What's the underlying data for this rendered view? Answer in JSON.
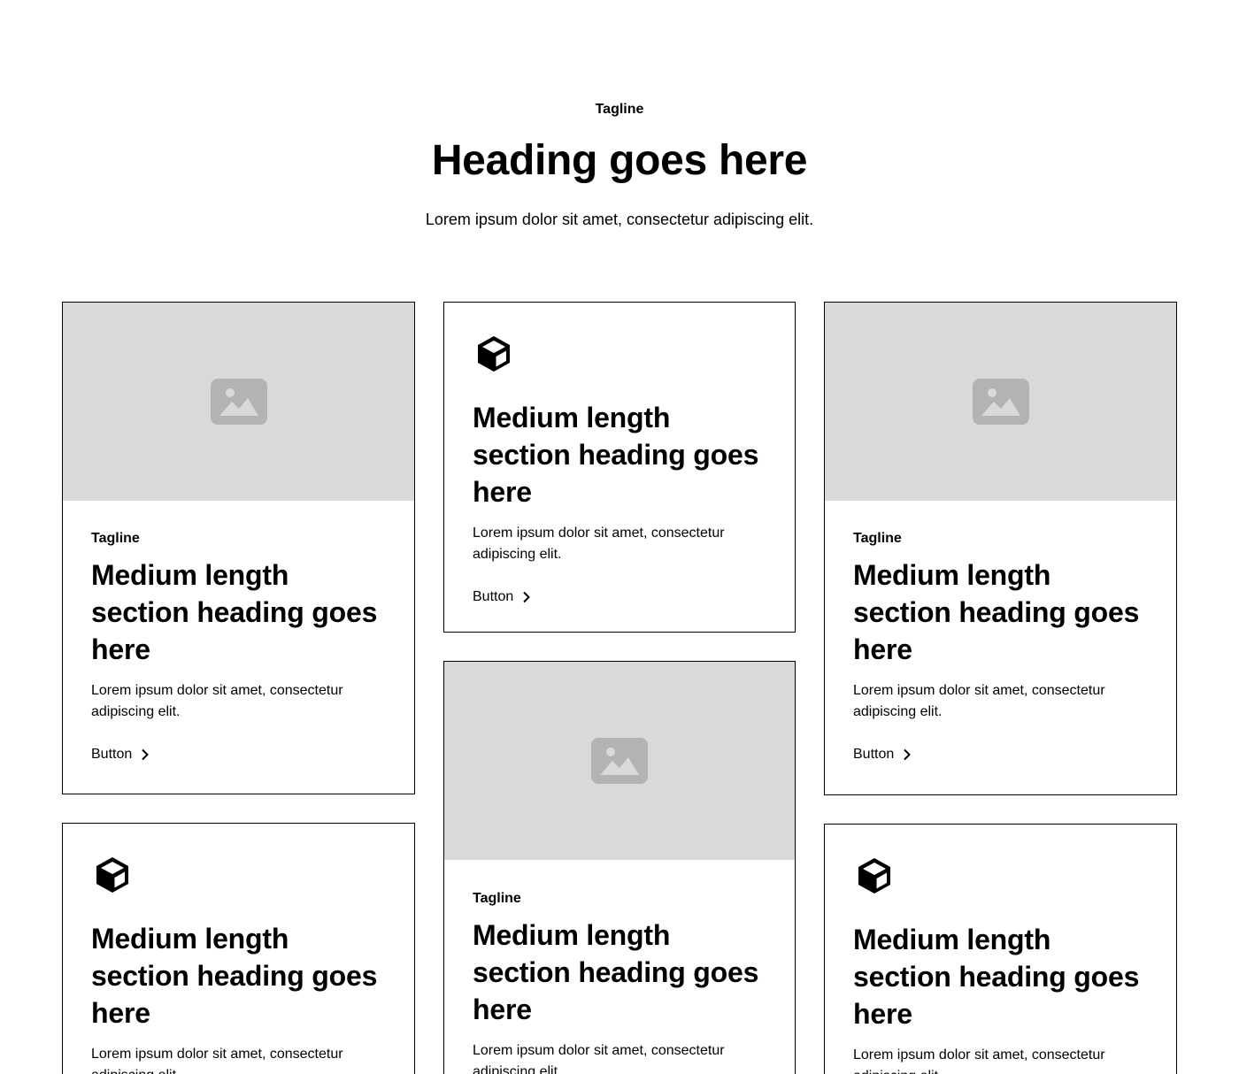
{
  "header": {
    "tagline": "Tagline",
    "title": "Heading goes here",
    "subtitle": "Lorem ipsum dolor sit amet, consectetur adipiscing elit."
  },
  "cards": [
    {
      "kind": "image",
      "tagline": "Tagline",
      "heading": "Medium length section heading goes here",
      "text": "Lorem ipsum dolor sit amet, consectetur adipiscing elit.",
      "button": "Button",
      "icon": "image-placeholder-icon"
    },
    {
      "kind": "icon",
      "heading": "Medium length section heading goes here",
      "text": "Lorem ipsum dolor sit amet, consectetur adipiscing elit.",
      "button": "Button",
      "icon": "cube-icon"
    },
    {
      "kind": "image",
      "tagline": "Tagline",
      "heading": "Medium length section heading goes here",
      "text": "Lorem ipsum dolor sit amet, consectetur adipiscing elit.",
      "button": "Button",
      "icon": "image-placeholder-icon"
    },
    {
      "kind": "icon",
      "heading": "Medium length section heading goes here",
      "text": "Lorem ipsum dolor sit amet, consectetur adipiscing elit.",
      "icon": "cube-icon"
    },
    {
      "kind": "image",
      "tagline": "Tagline",
      "heading": "Medium length section heading goes here",
      "text": "Lorem ipsum dolor sit amet, consectetur adipiscing elit.",
      "icon": "image-placeholder-icon"
    },
    {
      "kind": "icon",
      "heading": "Medium length section heading goes here",
      "text": "Lorem ipsum dolor sit amet, consectetur adipiscing elit.",
      "icon": "cube-icon"
    }
  ],
  "colors": {
    "placeholder_bg": "#d9d9d9",
    "placeholder_icon": "#b3b3b3",
    "border": "#000000"
  }
}
